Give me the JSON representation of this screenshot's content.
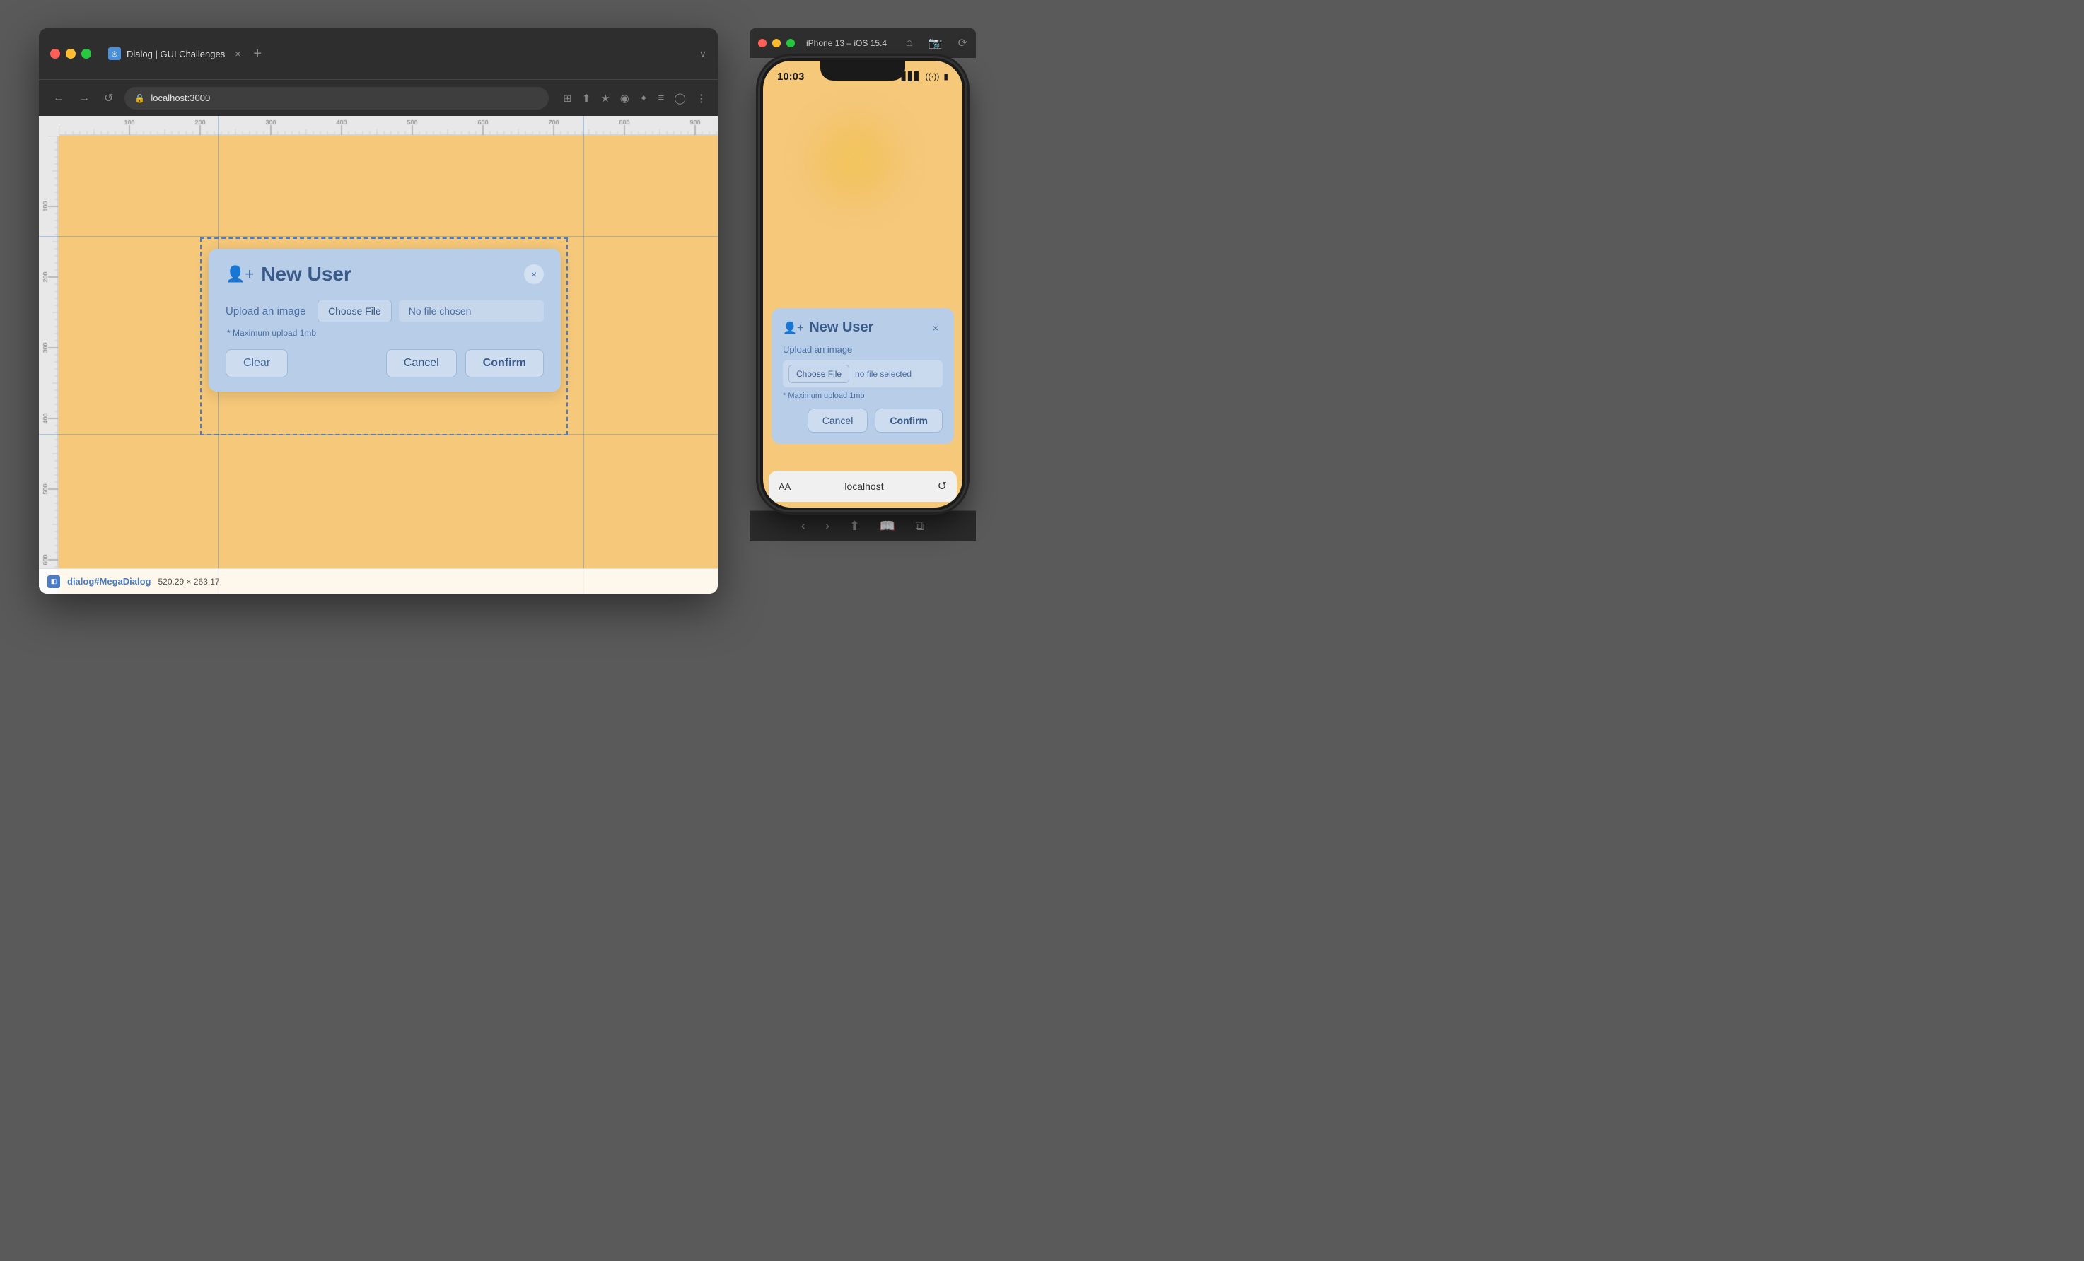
{
  "browser": {
    "tab_icon": "◎",
    "tab_label": "Dialog | GUI Challenges",
    "tab_close": "×",
    "tab_new": "+",
    "tab_expand": "∨",
    "nav_back": "←",
    "nav_forward": "→",
    "nav_reload": "↺",
    "address": "localhost:3000",
    "address_lock": "🔒",
    "toolbar_icons": [
      "⊞",
      "⬆",
      "★",
      "◉",
      "✦",
      "≡",
      "□",
      "⊕",
      "⋮"
    ]
  },
  "dialog": {
    "icon": "👤",
    "title": "New User",
    "close": "×",
    "upload_label": "Upload an image",
    "choose_file_label": "Choose File",
    "no_file_label": "No file chosen",
    "hint": "* Maximum upload 1mb",
    "clear_label": "Clear",
    "cancel_label": "Cancel",
    "confirm_label": "Confirm"
  },
  "info_bar": {
    "selector": "dialog#MegaDialog",
    "dimensions": "520.29 × 263.17"
  },
  "phone": {
    "window_title": "iPhone 13 – iOS 15.4",
    "time": "10:03",
    "signal": "▋▋▋",
    "wifi": "wifi",
    "battery": "■",
    "dialog": {
      "icon": "👤",
      "title": "New User",
      "close": "×",
      "upload_label": "Upload an image",
      "choose_file_label": "Choose File",
      "no_file_label": "no file selected",
      "hint": "* Maximum upload 1mb",
      "cancel_label": "Cancel",
      "confirm_label": "Confirm"
    },
    "address_bar": {
      "aa": "AA",
      "url": "localhost",
      "reload": "↺"
    }
  },
  "ruler": {
    "ticks_top": [
      "100",
      "200",
      "300",
      "400",
      "500",
      "600",
      "700",
      "800",
      "900"
    ],
    "ticks_left": [
      "100",
      "200",
      "300",
      "400",
      "500",
      "600"
    ]
  }
}
